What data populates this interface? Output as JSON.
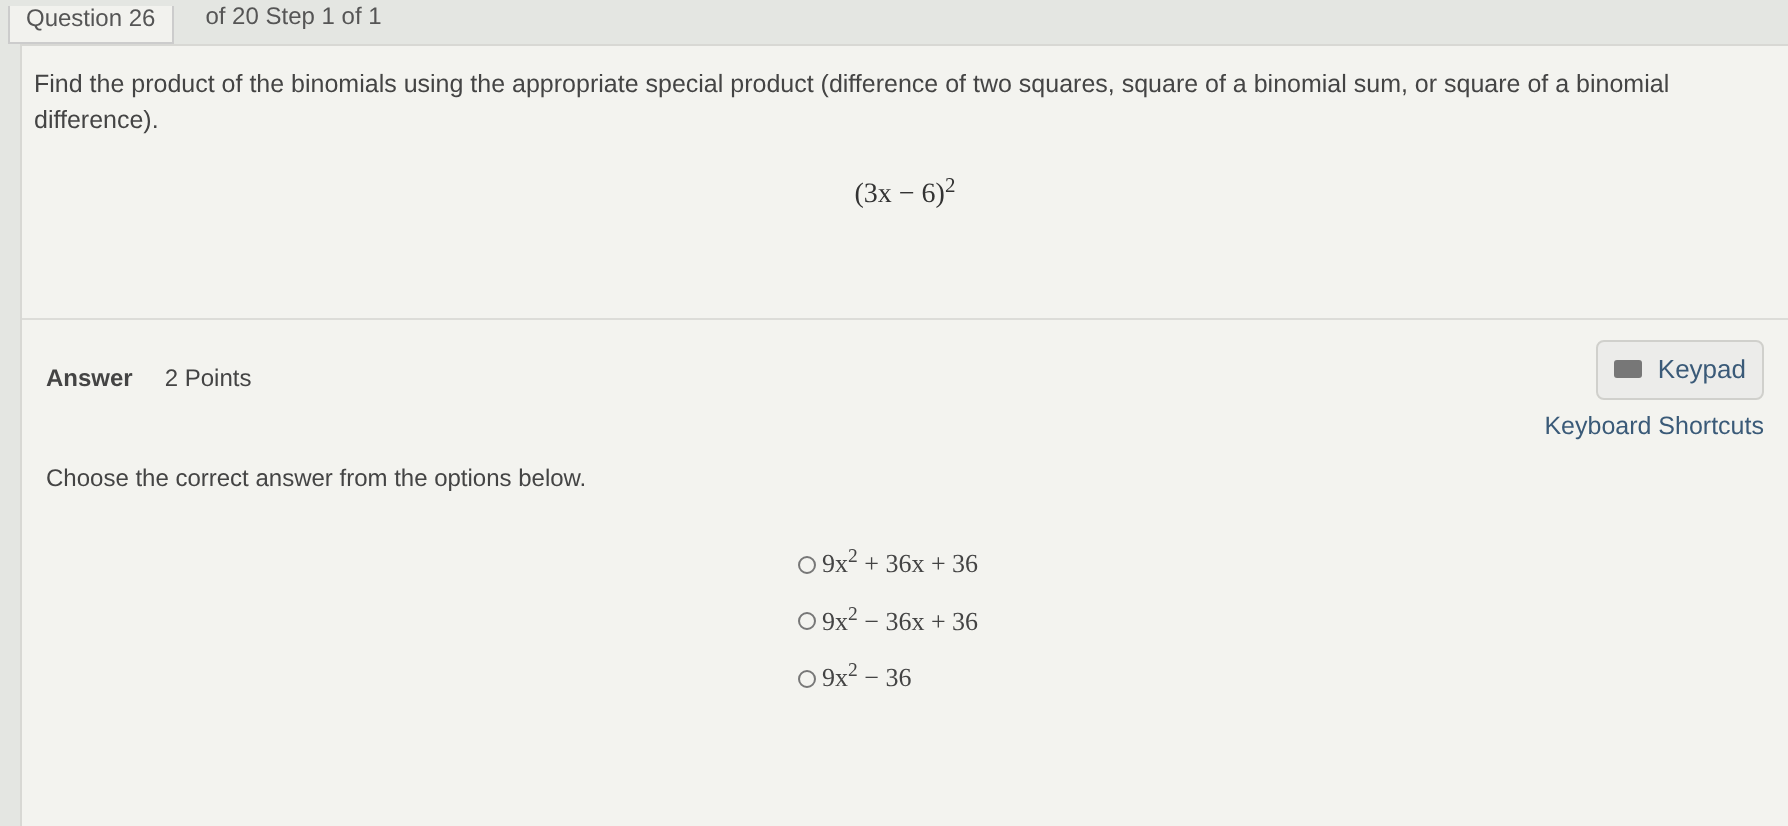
{
  "header": {
    "question": "Question 26",
    "step": "of 20 Step 1 of 1"
  },
  "prompt": "Find the product of the binomials using the appropriate special product (difference of two squares, square of a binomial sum, or square of a binomial difference).",
  "expression": "(3x − 6)$^{2}$",
  "answer": {
    "label": "Answer",
    "points": "2 Points",
    "keypad": "Keypad",
    "shortcuts": "Keyboard Shortcuts",
    "instruction": "Choose the correct answer from the options below."
  },
  "options": [
    {
      "text": "9x$^{2}$ + 36x + 36",
      "selected": false
    },
    {
      "text": "9x$^{2}$ − 36x + 36",
      "selected": false
    },
    {
      "text": "9x$^{2}$ − 36",
      "selected": false
    }
  ]
}
